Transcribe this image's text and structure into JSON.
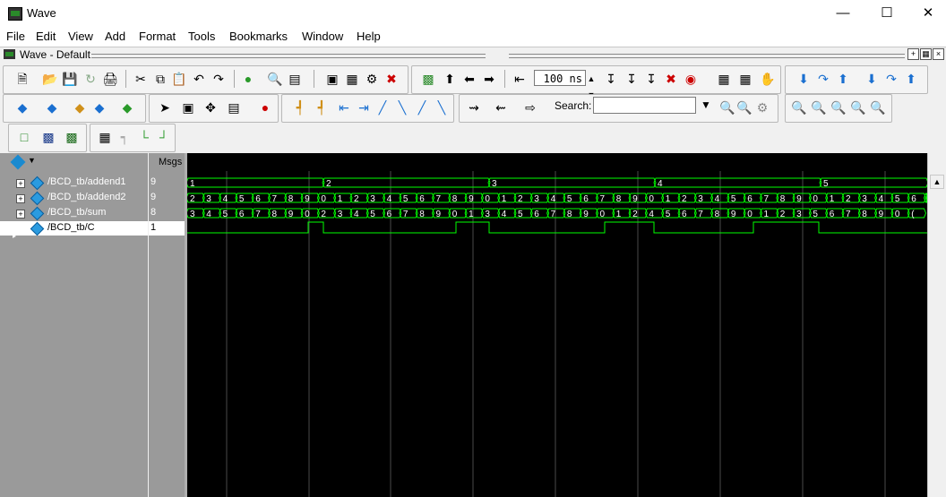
{
  "window": {
    "title": "Wave"
  },
  "menubar": [
    "File",
    "Edit",
    "View",
    "Add",
    "Format",
    "Tools",
    "Bookmarks",
    "Window",
    "Help"
  ],
  "pane": {
    "title": "Wave - Default"
  },
  "toolbar": {
    "time_value": "100 ns",
    "search_label": "Search:",
    "search_value": ""
  },
  "wave": {
    "msgs_header": "Msgs",
    "signals": [
      {
        "name": "/BCD_tb/addend1",
        "value": "9",
        "expandable": true
      },
      {
        "name": "/BCD_tb/addend2",
        "value": "9",
        "expandable": true
      },
      {
        "name": "/BCD_tb/sum",
        "value": "8",
        "expandable": true
      },
      {
        "name": "/BCD_tb/C",
        "value": "1",
        "expandable": false
      }
    ],
    "addend1_values": [
      "1",
      "2",
      "3",
      "4",
      "5"
    ],
    "addend2_values": [
      "2",
      "3",
      "4",
      "5",
      "6",
      "7",
      "8",
      "9",
      "0",
      "1",
      "2",
      "3",
      "4",
      "5",
      "6",
      "7",
      "8",
      "9",
      "0",
      "1",
      "2",
      "3",
      "4",
      "5",
      "6",
      "7",
      "8",
      "9",
      "0",
      "1",
      "2",
      "3",
      "4",
      "5",
      "6",
      "7",
      "8",
      "9",
      "0",
      "1",
      "2",
      "3",
      "4",
      "5",
      "6",
      "7",
      "8",
      "9",
      "0",
      "1",
      "2",
      "3",
      "4",
      "5",
      "("
    ],
    "sum_values": [
      "3",
      "4",
      "5",
      "6",
      "7",
      "8",
      "9",
      "0",
      "2",
      "3",
      "4",
      "5",
      "6",
      "7",
      "8",
      "9",
      "0",
      "1",
      "3",
      "4",
      "5",
      "6",
      "7",
      "8",
      "9",
      "0",
      "1",
      "2",
      "4",
      "5",
      "6",
      "7",
      "8",
      "9",
      "0",
      "1",
      "2",
      "3",
      "5",
      "6",
      "7",
      "8",
      "9",
      "0",
      "("
    ],
    "carry_values": [
      0,
      1,
      0,
      1,
      0,
      1,
      0,
      1,
      0
    ],
    "colors": {
      "background": "#000000",
      "signal": "#00ff00",
      "grid": "#4a4a4a",
      "pane": "#9a9a9a"
    }
  }
}
